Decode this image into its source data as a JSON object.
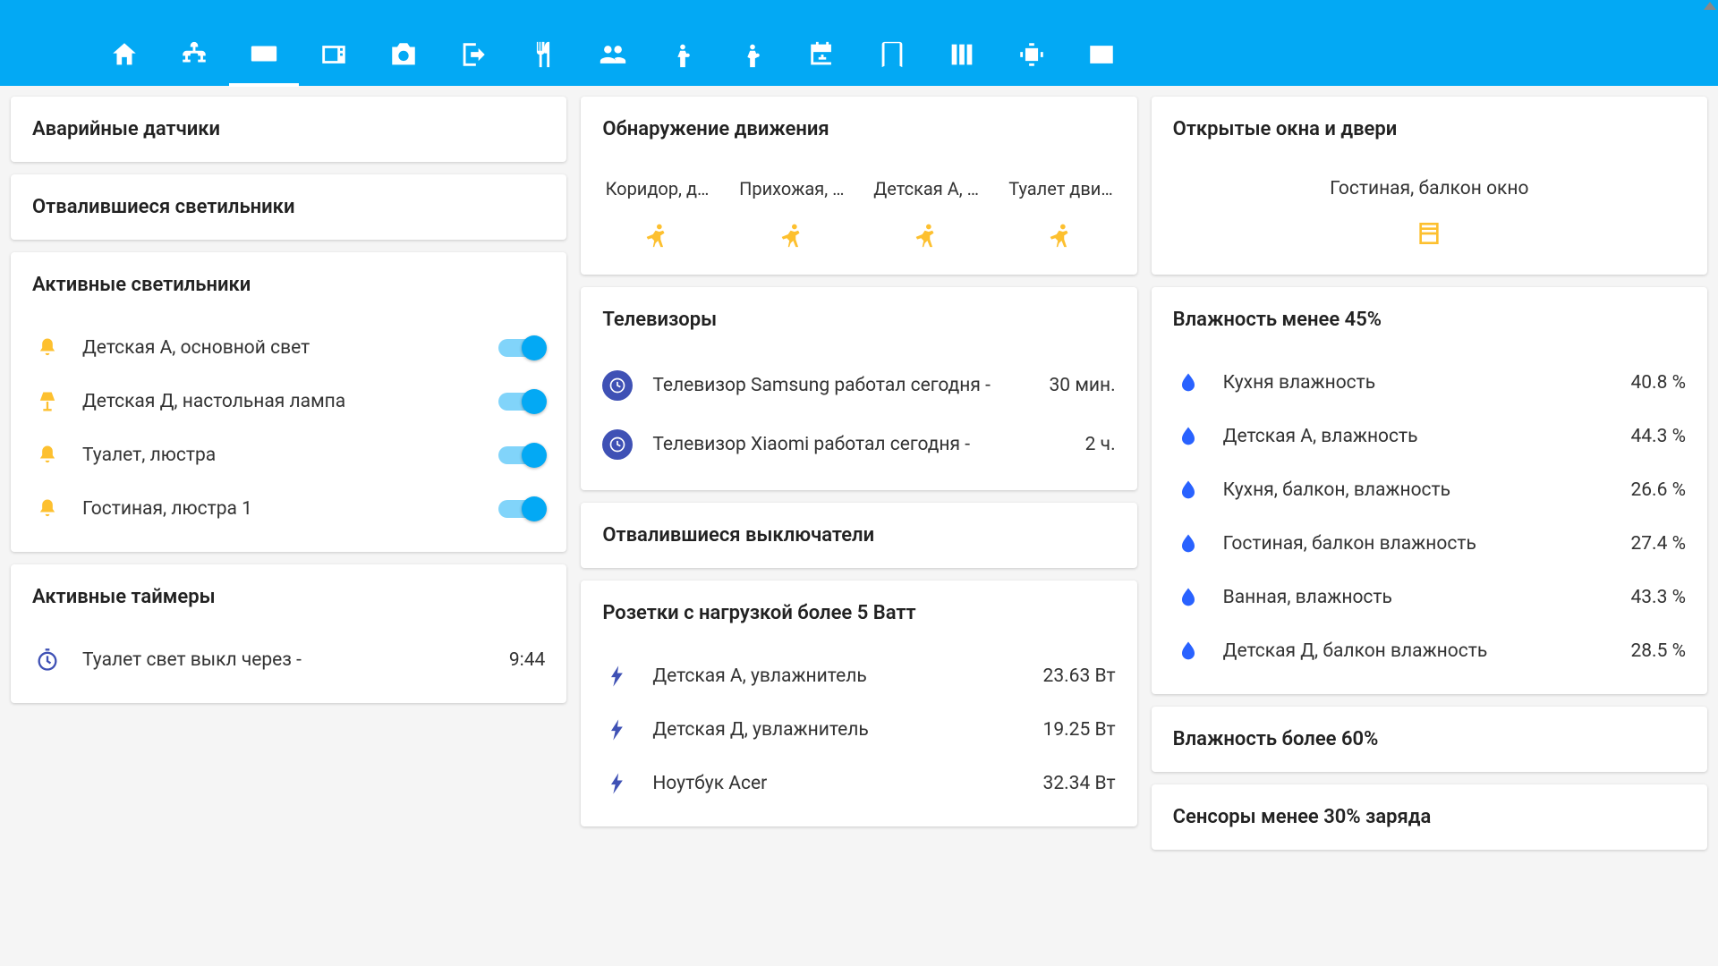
{
  "nav": {
    "tabs": [
      "home",
      "network",
      "keyboard",
      "microwave",
      "camera",
      "exit",
      "utensils",
      "people",
      "person-down",
      "person-up",
      "calendar",
      "book",
      "columns",
      "chip",
      "terminal"
    ]
  },
  "col1": {
    "alarm_sensors_title": "Аварийные датчики",
    "lost_lights_title": "Отвалившиеся светильники",
    "active_lights_title": "Активные светильники",
    "lights": [
      {
        "name": "Детская А, основной свет",
        "icon": "bell",
        "on": true
      },
      {
        "name": "Детская Д, настольная лампа",
        "icon": "lamp",
        "on": true
      },
      {
        "name": "Туалет, люстра",
        "icon": "bell",
        "on": true
      },
      {
        "name": "Гостиная, люстра 1",
        "icon": "bell",
        "on": true
      }
    ],
    "active_timers_title": "Активные таймеры",
    "timer": {
      "name": "Туалет свет выкл через -",
      "value": "9:44"
    }
  },
  "col2": {
    "motion_title": "Обнаружение движения",
    "motion": [
      {
        "label": "Коридор, д…"
      },
      {
        "label": "Прихожая, …"
      },
      {
        "label": "Детская А, …"
      },
      {
        "label": "Туалет дви…"
      }
    ],
    "tv_title": "Телевизоры",
    "tvs": [
      {
        "name": "Телевизор Samsung работал сегодня -",
        "value": "30 мин."
      },
      {
        "name": "Телевизор Xiaomi работал сегодня -",
        "value": "2 ч."
      }
    ],
    "lost_switches_title": "Отвалившиеся выключатели",
    "sockets_title": "Розетки с нагрузкой более 5 Ватт",
    "sockets": [
      {
        "name": "Детская А, увлажнитель",
        "value": "23.63 Вт"
      },
      {
        "name": "Детская Д, увлажнитель",
        "value": "19.25 Вт"
      },
      {
        "name": "Ноутбук Acer",
        "value": "32.34 Вт"
      }
    ]
  },
  "col3": {
    "open_title": "Открытые окна и двери",
    "open_item": "Гостиная, балкон окно",
    "humidity_low_title": "Влажность менее 45%",
    "humidity": [
      {
        "name": "Кухня влажность",
        "value": "40.8 %"
      },
      {
        "name": "Детская А, влажность",
        "value": "44.3 %"
      },
      {
        "name": "Кухня, балкон, влажность",
        "value": "26.6 %"
      },
      {
        "name": "Гостиная, балкон влажность",
        "value": "27.4 %"
      },
      {
        "name": "Ванная, влажность",
        "value": "43.3 %"
      },
      {
        "name": "Детская Д, балкон влажность",
        "value": "28.5 %"
      }
    ],
    "humidity_high_title": "Влажность более 60%",
    "sensors_low_title": "Сенсоры менее 30% заряда"
  }
}
